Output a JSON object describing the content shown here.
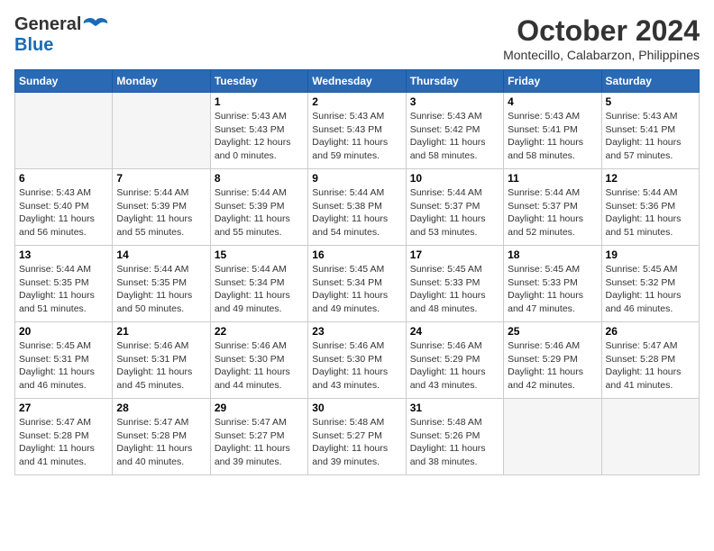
{
  "header": {
    "logo_general": "General",
    "logo_blue": "Blue",
    "month_title": "October 2024",
    "location": "Montecillo, Calabarzon, Philippines"
  },
  "days_of_week": [
    "Sunday",
    "Monday",
    "Tuesday",
    "Wednesday",
    "Thursday",
    "Friday",
    "Saturday"
  ],
  "weeks": [
    [
      {
        "date": "",
        "info": ""
      },
      {
        "date": "",
        "info": ""
      },
      {
        "date": "1",
        "sunrise": "5:43 AM",
        "sunset": "5:43 PM",
        "daylight": "12 hours and 0 minutes."
      },
      {
        "date": "2",
        "sunrise": "5:43 AM",
        "sunset": "5:43 PM",
        "daylight": "11 hours and 59 minutes."
      },
      {
        "date": "3",
        "sunrise": "5:43 AM",
        "sunset": "5:42 PM",
        "daylight": "11 hours and 58 minutes."
      },
      {
        "date": "4",
        "sunrise": "5:43 AM",
        "sunset": "5:41 PM",
        "daylight": "11 hours and 58 minutes."
      },
      {
        "date": "5",
        "sunrise": "5:43 AM",
        "sunset": "5:41 PM",
        "daylight": "11 hours and 57 minutes."
      }
    ],
    [
      {
        "date": "6",
        "sunrise": "5:43 AM",
        "sunset": "5:40 PM",
        "daylight": "11 hours and 56 minutes."
      },
      {
        "date": "7",
        "sunrise": "5:44 AM",
        "sunset": "5:39 PM",
        "daylight": "11 hours and 55 minutes."
      },
      {
        "date": "8",
        "sunrise": "5:44 AM",
        "sunset": "5:39 PM",
        "daylight": "11 hours and 55 minutes."
      },
      {
        "date": "9",
        "sunrise": "5:44 AM",
        "sunset": "5:38 PM",
        "daylight": "11 hours and 54 minutes."
      },
      {
        "date": "10",
        "sunrise": "5:44 AM",
        "sunset": "5:37 PM",
        "daylight": "11 hours and 53 minutes."
      },
      {
        "date": "11",
        "sunrise": "5:44 AM",
        "sunset": "5:37 PM",
        "daylight": "11 hours and 52 minutes."
      },
      {
        "date": "12",
        "sunrise": "5:44 AM",
        "sunset": "5:36 PM",
        "daylight": "11 hours and 51 minutes."
      }
    ],
    [
      {
        "date": "13",
        "sunrise": "5:44 AM",
        "sunset": "5:35 PM",
        "daylight": "11 hours and 51 minutes."
      },
      {
        "date": "14",
        "sunrise": "5:44 AM",
        "sunset": "5:35 PM",
        "daylight": "11 hours and 50 minutes."
      },
      {
        "date": "15",
        "sunrise": "5:44 AM",
        "sunset": "5:34 PM",
        "daylight": "11 hours and 49 minutes."
      },
      {
        "date": "16",
        "sunrise": "5:45 AM",
        "sunset": "5:34 PM",
        "daylight": "11 hours and 49 minutes."
      },
      {
        "date": "17",
        "sunrise": "5:45 AM",
        "sunset": "5:33 PM",
        "daylight": "11 hours and 48 minutes."
      },
      {
        "date": "18",
        "sunrise": "5:45 AM",
        "sunset": "5:33 PM",
        "daylight": "11 hours and 47 minutes."
      },
      {
        "date": "19",
        "sunrise": "5:45 AM",
        "sunset": "5:32 PM",
        "daylight": "11 hours and 46 minutes."
      }
    ],
    [
      {
        "date": "20",
        "sunrise": "5:45 AM",
        "sunset": "5:31 PM",
        "daylight": "11 hours and 46 minutes."
      },
      {
        "date": "21",
        "sunrise": "5:46 AM",
        "sunset": "5:31 PM",
        "daylight": "11 hours and 45 minutes."
      },
      {
        "date": "22",
        "sunrise": "5:46 AM",
        "sunset": "5:30 PM",
        "daylight": "11 hours and 44 minutes."
      },
      {
        "date": "23",
        "sunrise": "5:46 AM",
        "sunset": "5:30 PM",
        "daylight": "11 hours and 43 minutes."
      },
      {
        "date": "24",
        "sunrise": "5:46 AM",
        "sunset": "5:29 PM",
        "daylight": "11 hours and 43 minutes."
      },
      {
        "date": "25",
        "sunrise": "5:46 AM",
        "sunset": "5:29 PM",
        "daylight": "11 hours and 42 minutes."
      },
      {
        "date": "26",
        "sunrise": "5:47 AM",
        "sunset": "5:28 PM",
        "daylight": "11 hours and 41 minutes."
      }
    ],
    [
      {
        "date": "27",
        "sunrise": "5:47 AM",
        "sunset": "5:28 PM",
        "daylight": "11 hours and 41 minutes."
      },
      {
        "date": "28",
        "sunrise": "5:47 AM",
        "sunset": "5:28 PM",
        "daylight": "11 hours and 40 minutes."
      },
      {
        "date": "29",
        "sunrise": "5:47 AM",
        "sunset": "5:27 PM",
        "daylight": "11 hours and 39 minutes."
      },
      {
        "date": "30",
        "sunrise": "5:48 AM",
        "sunset": "5:27 PM",
        "daylight": "11 hours and 39 minutes."
      },
      {
        "date": "31",
        "sunrise": "5:48 AM",
        "sunset": "5:26 PM",
        "daylight": "11 hours and 38 minutes."
      },
      {
        "date": "",
        "info": ""
      },
      {
        "date": "",
        "info": ""
      }
    ]
  ],
  "labels": {
    "sunrise": "Sunrise:",
    "sunset": "Sunset:",
    "daylight": "Daylight:"
  }
}
